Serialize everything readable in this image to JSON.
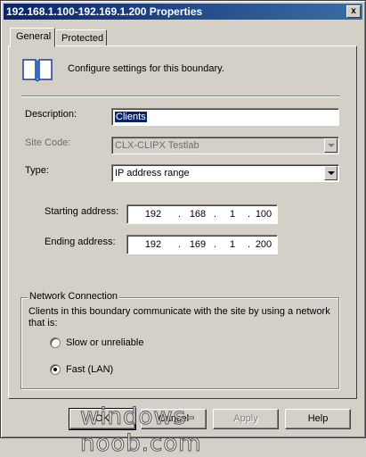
{
  "window": {
    "title": "192.168.1.100-192.169.1.200 Properties",
    "close_glyph": "x"
  },
  "tabs": [
    {
      "label": "General",
      "active": true
    },
    {
      "label": "Protected",
      "active": false
    }
  ],
  "header": {
    "icon": "boundary-book-icon",
    "text": "Configure settings for this boundary."
  },
  "form": {
    "description_label": "Description:",
    "description_value": "Clients",
    "site_code_label": "Site Code:",
    "site_code_value": "CLX-CLIPX Testlab",
    "type_label": "Type:",
    "type_value": "IP address range",
    "starting_label": "Starting address:",
    "starting_octets": [
      "192",
      "168",
      "1",
      "100"
    ],
    "ending_label": "Ending address:",
    "ending_octets": [
      "192",
      "169",
      "1",
      "200"
    ],
    "octet_separator": "."
  },
  "network": {
    "legend": "Network Connection",
    "description_line1": "Clients in this boundary communicate with the site by using a network",
    "description_line2": "that is:",
    "options": [
      {
        "label": "Slow or unreliable",
        "selected": false
      },
      {
        "label": "Fast (LAN)",
        "selected": true
      }
    ]
  },
  "buttons": {
    "ok": "OK",
    "cancel": "Cancel",
    "apply": "Apply",
    "help": "Help"
  },
  "watermark": "windows-noob.com",
  "colors": {
    "title_gradient_start": "#0a246a",
    "title_gradient_end": "#3a6ea5",
    "dialog_face": "#d4d0c8",
    "selection": "#0a246a"
  }
}
